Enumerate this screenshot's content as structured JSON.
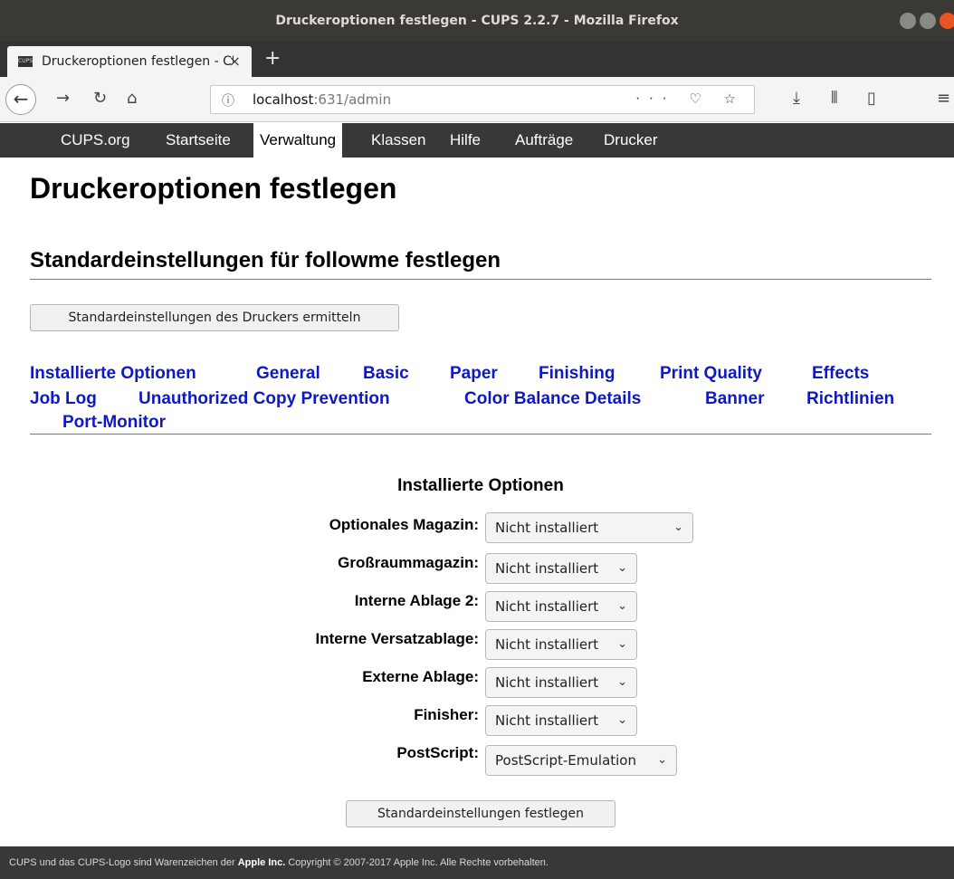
{
  "window": {
    "title": "Druckeroptionen festlegen - CUPS 2.2.7 - Mozilla Firefox"
  },
  "browser": {
    "tab_title": "Druckeroptionen festlegen - CUPS 2.2.7",
    "favicon_text": "CUPS",
    "tab_close": "×",
    "new_tab": "+",
    "url_host": "localhost",
    "url_rest": ":631/admin",
    "url_info_icon": "info-icon",
    "url_actions": "··· ♡ ☆",
    "nav_icons": [
      "back-icon",
      "forward-icon",
      "reload-icon",
      "home-icon",
      "download-icon",
      "library-icon",
      "sidebar-icon",
      "menu-icon"
    ]
  },
  "cups_nav": {
    "items": [
      "CUPS.org",
      "Startseite",
      "Verwaltung",
      "Klassen",
      "Hilfe",
      "Aufträge",
      "Drucker"
    ],
    "active": "Verwaltung"
  },
  "page": {
    "h1": "Druckeroptionen festlegen",
    "h2": "Standardeinstellungen für followme festlegen",
    "query_button": "Standardeinstellungen des Druckers ermitteln",
    "option_tabs": [
      "Installierte Optionen",
      "General",
      "Basic",
      "Paper",
      "Finishing",
      "Print Quality",
      "Effects",
      "Job Log",
      "Unauthorized Copy Prevention",
      "Color Balance Details",
      "Banner",
      "Richtlinien",
      "Port-Monitor"
    ],
    "section_title": "Installierte Optionen",
    "options": [
      {
        "label": "Optionales Magazin:",
        "value": "Nicht installiert"
      },
      {
        "label": "Großraummagazin:",
        "value": "Nicht installiert"
      },
      {
        "label": "Interne Ablage 2:",
        "value": "Nicht installiert"
      },
      {
        "label": "Interne Versatzablage:",
        "value": "Nicht installiert"
      },
      {
        "label": "Externe Ablage:",
        "value": "Nicht installiert"
      },
      {
        "label": "Finisher:",
        "value": "Nicht installiert"
      },
      {
        "label": "PostScript:",
        "value": "PostScript-Emulation"
      }
    ],
    "submit_button": "Standardeinstellungen festlegen"
  },
  "footer": {
    "text_before": "CUPS und das CUPS-Logo sind Warenzeichen der ",
    "company": "Apple Inc.",
    "text_after": " Copyright © 2007-2017 Apple Inc. Alle Rechte vorbehalten."
  },
  "colors": {
    "link": "#0f19c1",
    "nav_bg": "#383838",
    "titlebar": "#3a3935",
    "close_button": "#e95420"
  }
}
